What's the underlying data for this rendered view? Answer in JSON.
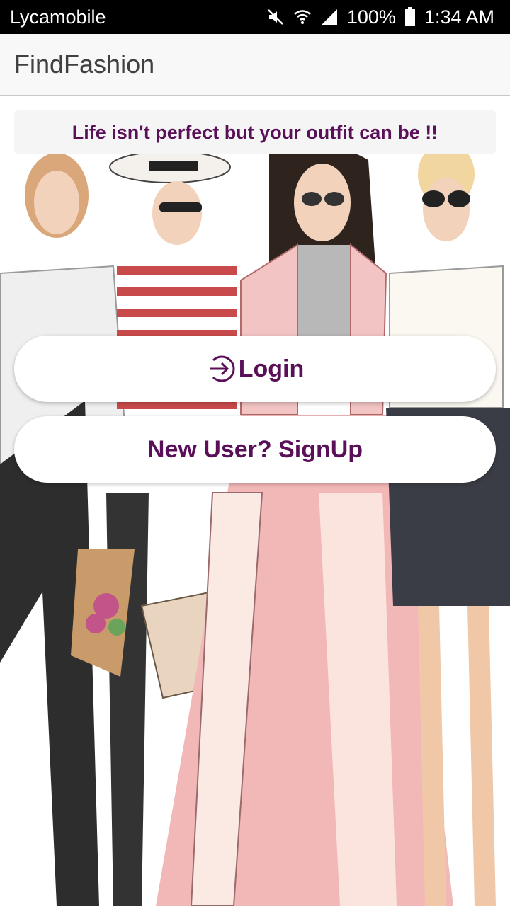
{
  "status_bar": {
    "carrier": "Lycamobile",
    "battery": "100%",
    "time": "1:34 AM",
    "icons": [
      "mute-icon",
      "wifi-icon",
      "signal-icon",
      "battery-icon"
    ]
  },
  "app_bar": {
    "title": "FindFashion"
  },
  "tagline": "Life isn't perfect but your outfit can be !!",
  "buttons": {
    "login": {
      "label": "Login",
      "icon": "login-arrow-icon"
    },
    "signup": {
      "label": "New User? SignUp"
    }
  },
  "colors": {
    "accent": "#5a0f59",
    "status_bar": "#000000",
    "app_bar": "#f8f8f8"
  },
  "background": "fashion-illustration-women-group"
}
